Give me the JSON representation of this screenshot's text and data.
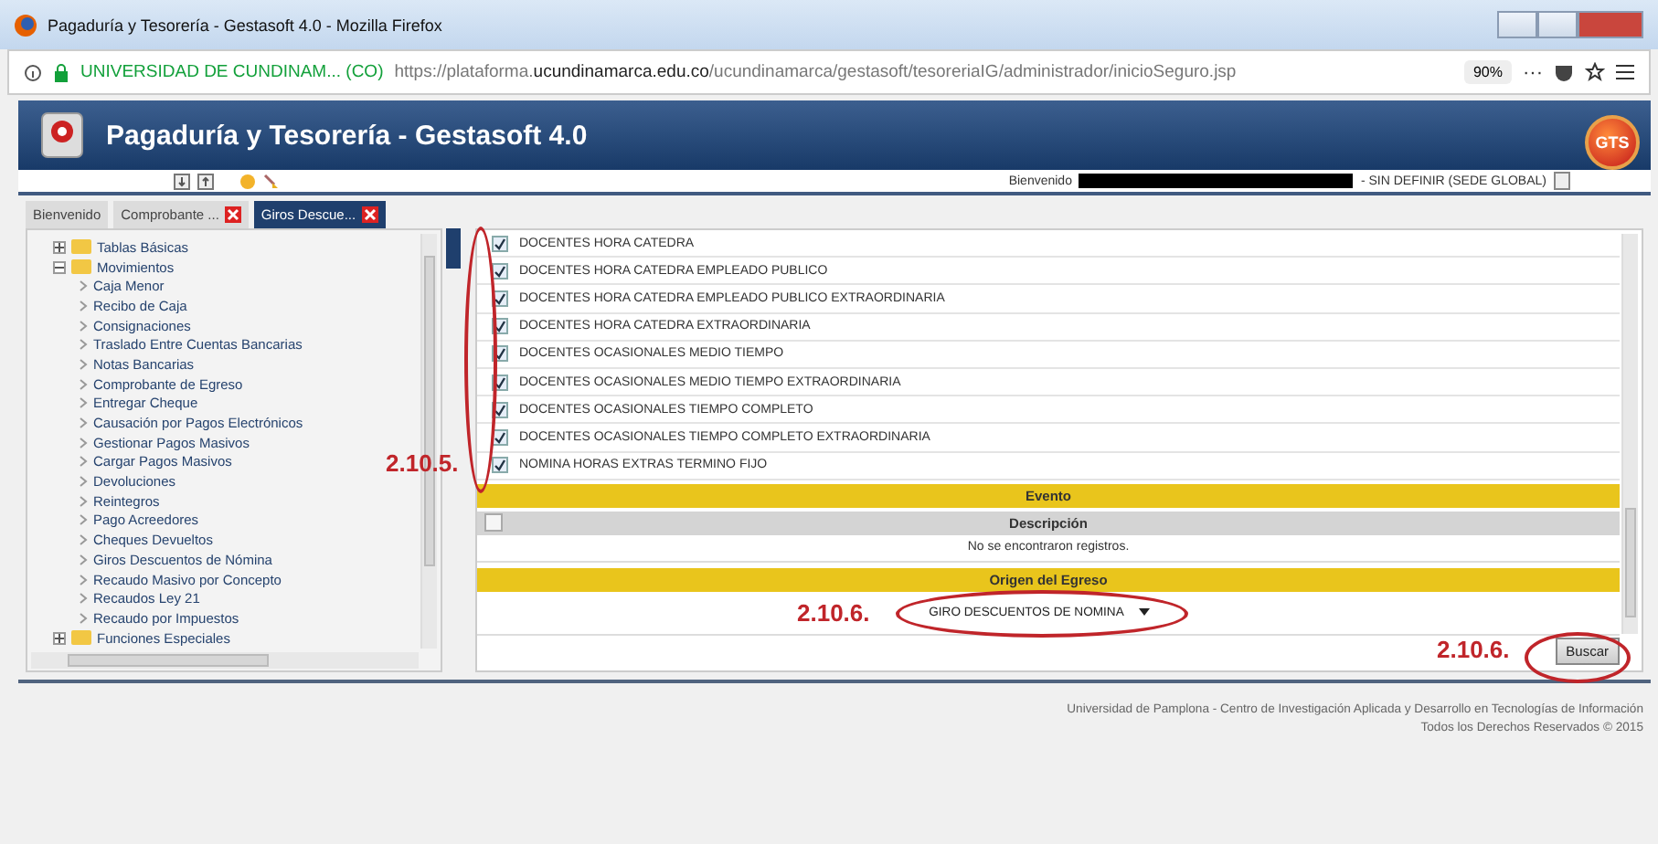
{
  "window": {
    "title": "Pagaduría y Tesorería - Gestasoft 4.0 - Mozilla Firefox"
  },
  "address_bar": {
    "site": "UNIVERSIDAD DE CUNDINAM... (CO)",
    "url_prefix": "https://plataforma.",
    "url_domain": "ucundinamarca.edu.co",
    "url_path": "/ucundinamarca/gestasoft/tesoreriaIG/administrador/inicioSeguro.jsp",
    "zoom": "90%",
    "more": "···"
  },
  "app": {
    "title": "Pagaduría y Tesorería - Gestasoft 4.0",
    "welcome": "Bienvenido",
    "sede": "- SIN DEFINIR (SEDE GLOBAL)",
    "logo": "GTS"
  },
  "tabs": [
    {
      "label": "Bienvenido",
      "selected": false,
      "closable": false
    },
    {
      "label": "Comprobante ...",
      "selected": false,
      "closable": true
    },
    {
      "label": "Giros Descue...",
      "selected": true,
      "closable": true
    }
  ],
  "tree": [
    {
      "label": "Tablas Básicas",
      "expanded": false
    },
    {
      "label": "Movimientos",
      "expanded": true,
      "children": [
        {
          "label": "Caja Menor"
        },
        {
          "label": "Recibo de Caja"
        },
        {
          "label": "Consignaciones"
        },
        {
          "label": "Traslado Entre Cuentas Bancarias"
        },
        {
          "label": "Notas Bancarias"
        },
        {
          "label": "Comprobante de Egreso"
        },
        {
          "label": "Entregar Cheque"
        },
        {
          "label": "Causación por Pagos Electrónicos"
        },
        {
          "label": "Gestionar Pagos Masivos"
        },
        {
          "label": "Cargar Pagos Masivos"
        },
        {
          "label": "Devoluciones"
        },
        {
          "label": "Reintegros"
        },
        {
          "label": "Pago Acreedores"
        },
        {
          "label": "Cheques Devueltos"
        },
        {
          "label": "Giros Descuentos de Nómina"
        },
        {
          "label": "Recaudo Masivo por Concepto"
        },
        {
          "label": "Recaudos Ley 21"
        },
        {
          "label": "Recaudo por Impuestos"
        }
      ]
    },
    {
      "label": "Funciones Especiales",
      "expanded": false
    }
  ],
  "nominas": [
    {
      "label": "DOCENTES HORA CATEDRA",
      "checked": true
    },
    {
      "label": "DOCENTES HORA CATEDRA EMPLEADO PUBLICO",
      "checked": true
    },
    {
      "label": "DOCENTES HORA CATEDRA EMPLEADO PUBLICO EXTRAORDINARIA",
      "checked": true
    },
    {
      "label": "DOCENTES HORA CATEDRA EXTRAORDINARIA",
      "checked": true
    },
    {
      "label": "DOCENTES OCASIONALES MEDIO TIEMPO",
      "checked": true
    },
    {
      "label": "DOCENTES OCASIONALES MEDIO TIEMPO EXTRAORDINARIA",
      "checked": true
    },
    {
      "label": "DOCENTES OCASIONALES TIEMPO COMPLETO",
      "checked": true
    },
    {
      "label": "DOCENTES OCASIONALES TIEMPO COMPLETO EXTRAORDINARIA",
      "checked": true
    },
    {
      "label": "NOMINA HORAS EXTRAS TERMINO FIJO",
      "checked": true
    }
  ],
  "evento": {
    "title": "Evento",
    "column": "Descripción",
    "select_all_checked": false,
    "empty": "No se encontraron registros."
  },
  "origen": {
    "title": "Origen del Egreso",
    "value": "GIRO DESCUENTOS DE NOMINA"
  },
  "search_button": "Buscar",
  "footer": [
    "Universidad de Pamplona - Centro de Investigación Aplicada y Desarrollo en Tecnologías de Información",
    "Todos los Derechos Reservados © 2015"
  ],
  "annotations": [
    "2.10.5.",
    "2.10.6.",
    "2.10.6."
  ]
}
